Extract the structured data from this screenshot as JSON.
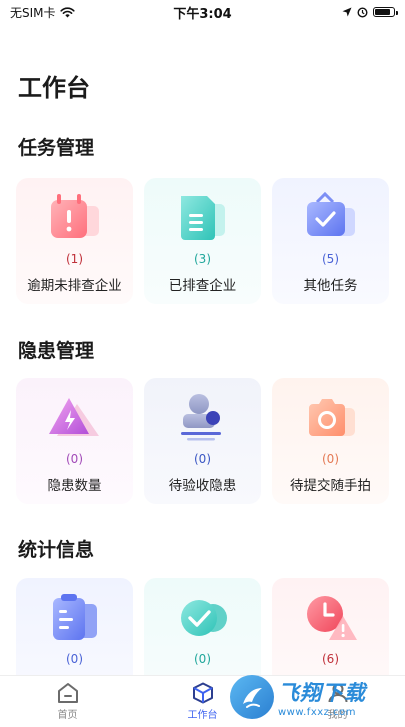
{
  "status_bar": {
    "carrier": "无SIM卡",
    "time": "下午3:04"
  },
  "page": {
    "title": "工作台"
  },
  "sections": [
    {
      "title": "任务管理",
      "cards": [
        {
          "count": "(1)",
          "label": "逾期未排查企业",
          "count_color": "#c0313a"
        },
        {
          "count": "(3)",
          "label": "已排查企业",
          "count_color": "#21a79c"
        },
        {
          "count": "(5)",
          "label": "其他任务",
          "count_color": "#4a63d6"
        }
      ]
    },
    {
      "title": "隐患管理",
      "cards": [
        {
          "count": "(0)",
          "label": "隐患数量",
          "count_color": "#a24bb8"
        },
        {
          "count": "(0)",
          "label": "待验收隐患",
          "count_color": "#3b57c4"
        },
        {
          "count": "(0)",
          "label": "待提交随手拍",
          "count_color": "#e47a55"
        }
      ]
    },
    {
      "title": "统计信息",
      "cards": [
        {
          "count": "(0)",
          "label": "",
          "count_color": "#4a63d6"
        },
        {
          "count": "(0)",
          "label": "",
          "count_color": "#21a79c"
        },
        {
          "count": "(6)",
          "label": "",
          "count_color": "#c0313a"
        }
      ]
    }
  ],
  "tab_bar": {
    "tabs": [
      {
        "label": "首页",
        "active": false
      },
      {
        "label": "工作台",
        "active": true
      },
      {
        "label": "我的",
        "active": false
      }
    ]
  },
  "watermark": {
    "brand": "飞翔下载",
    "url": "www.fxxz.com"
  },
  "colors": {
    "accent": "#3e63f0"
  }
}
